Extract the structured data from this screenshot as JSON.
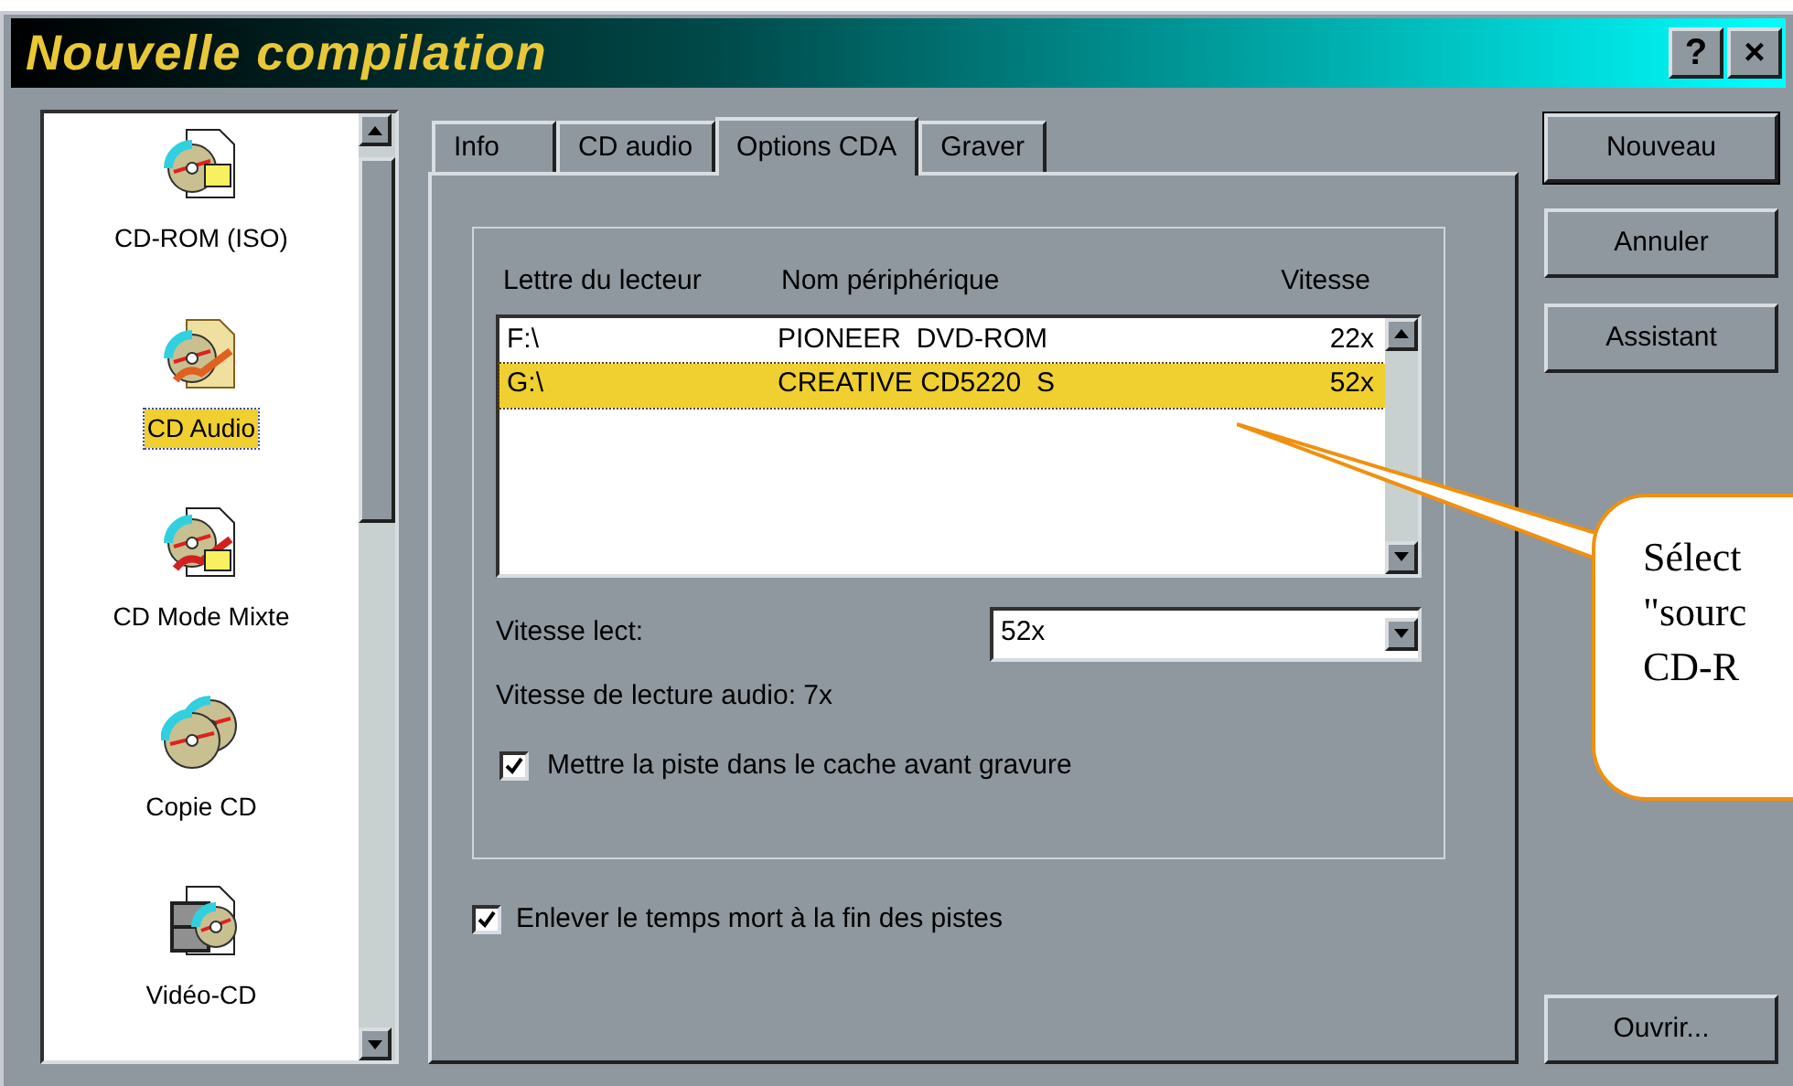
{
  "window": {
    "title": "Nouvelle compilation",
    "title_buttons": [
      "?",
      "×"
    ]
  },
  "sidebar": {
    "items": [
      {
        "label": "CD-ROM (ISO)",
        "kind": "data",
        "selected": false
      },
      {
        "label": "CD Audio",
        "kind": "audio",
        "selected": true
      },
      {
        "label": "CD Mode Mixte",
        "kind": "mixed",
        "selected": false
      },
      {
        "label": "Copie CD",
        "kind": "copy",
        "selected": false
      },
      {
        "label": "Vidéo-CD",
        "kind": "video",
        "selected": false
      }
    ]
  },
  "tabs": [
    {
      "label": "Info",
      "selected": false
    },
    {
      "label": "CD audio",
      "selected": false
    },
    {
      "label": "Options CDA",
      "selected": true
    },
    {
      "label": "Graver",
      "selected": false
    }
  ],
  "drive_table": {
    "columns": [
      "Lettre du lecteur",
      "Nom périphérique",
      "Vitesse"
    ],
    "rows": [
      {
        "cells": [
          "F:\\",
          "PIONEER  DVD-ROM",
          "22x"
        ],
        "selected": false
      },
      {
        "cells": [
          "G:\\",
          "CREATIVE CD5220  S",
          "52x"
        ],
        "selected": true
      }
    ]
  },
  "read_speed": {
    "label": "Vitesse lect:",
    "value": "52x"
  },
  "audio_speed": "Vitesse de lecture audio: 7x",
  "cache_option": {
    "label": "Mettre la piste dans le cache avant gravure",
    "checked": true
  },
  "trim_option": {
    "label": "Enlever le temps mort à la fin des pistes",
    "checked": true
  },
  "buttons": [
    "Nouveau",
    "Annuler",
    "Assistant"
  ],
  "open_button": "Ouvrir...",
  "callout": {
    "lines": [
      "Sélect",
      "\"sourc",
      "CD-R"
    ]
  }
}
